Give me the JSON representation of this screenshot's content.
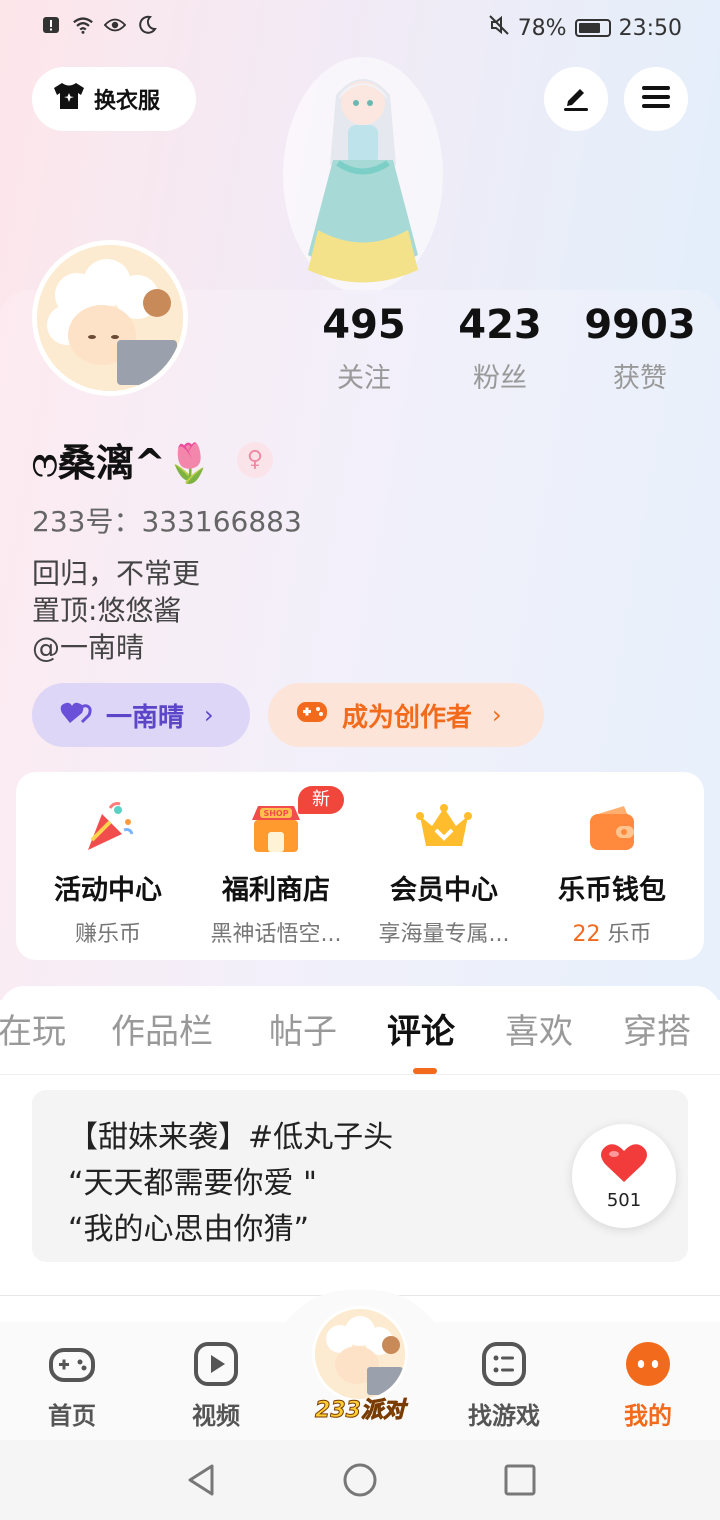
{
  "status_bar": {
    "battery_text": "78%",
    "battery_level": 0.78,
    "time": "23:50",
    "icons": [
      "alert-icon",
      "wifi-icon",
      "eye-icon",
      "moon-icon",
      "mute-icon"
    ]
  },
  "header": {
    "outfit_label": "换衣服",
    "edit_icon": "pen-icon",
    "menu_icon": "menu-icon"
  },
  "stats": [
    {
      "value": "495",
      "label": "关注"
    },
    {
      "value": "423",
      "label": "粉丝"
    },
    {
      "value": "9903",
      "label": "获赞"
    }
  ],
  "profile": {
    "nickname": "ෆ桑漓^🌷",
    "gender": "female",
    "uid_text": "233号：333166883",
    "bio_lines": [
      "回归，不常更",
      "置顶:悠悠酱",
      "@一南晴"
    ]
  },
  "pills": {
    "friend_label": "一南晴",
    "creator_label": "成为创作者",
    "chevron": "›"
  },
  "quick_entries": [
    {
      "title": "活动中心",
      "subtitle": "赚乐币",
      "icon": "party-popper-icon"
    },
    {
      "title": "福利商店",
      "subtitle": "黑神话悟空...",
      "icon": "shop-icon",
      "badge": "新",
      "shop_text": "SHOP"
    },
    {
      "title": "会员中心",
      "subtitle": "享海量专属...",
      "icon": "crown-icon"
    },
    {
      "title": "乐币钱包",
      "subtitle_value": "22",
      "subtitle_unit": "乐币",
      "icon": "wallet-icon"
    }
  ],
  "tabs": [
    "在玩",
    "作品栏",
    "帖子",
    "评论",
    "喜欢",
    "穿搭"
  ],
  "active_tab": "评论",
  "comment": {
    "lines": [
      "【甜妹来袭】#低丸子头",
      "“天天都需要你爱 \"",
      "“我的心思由你猜”"
    ],
    "likes": "501"
  },
  "bottom_nav": [
    {
      "label": "首页",
      "icon": "gamepad-icon"
    },
    {
      "label": "视频",
      "icon": "play-icon"
    },
    {
      "label": "233派对",
      "icon": "party-avatar-icon"
    },
    {
      "label": "找游戏",
      "icon": "list-icon"
    },
    {
      "label": "我的",
      "icon": "profile-icon"
    }
  ],
  "active_nav": "我的",
  "colors": {
    "accent_orange": "#f26a1b",
    "friend_purple": "#5b45c9",
    "badge_red": "#f0463c"
  }
}
